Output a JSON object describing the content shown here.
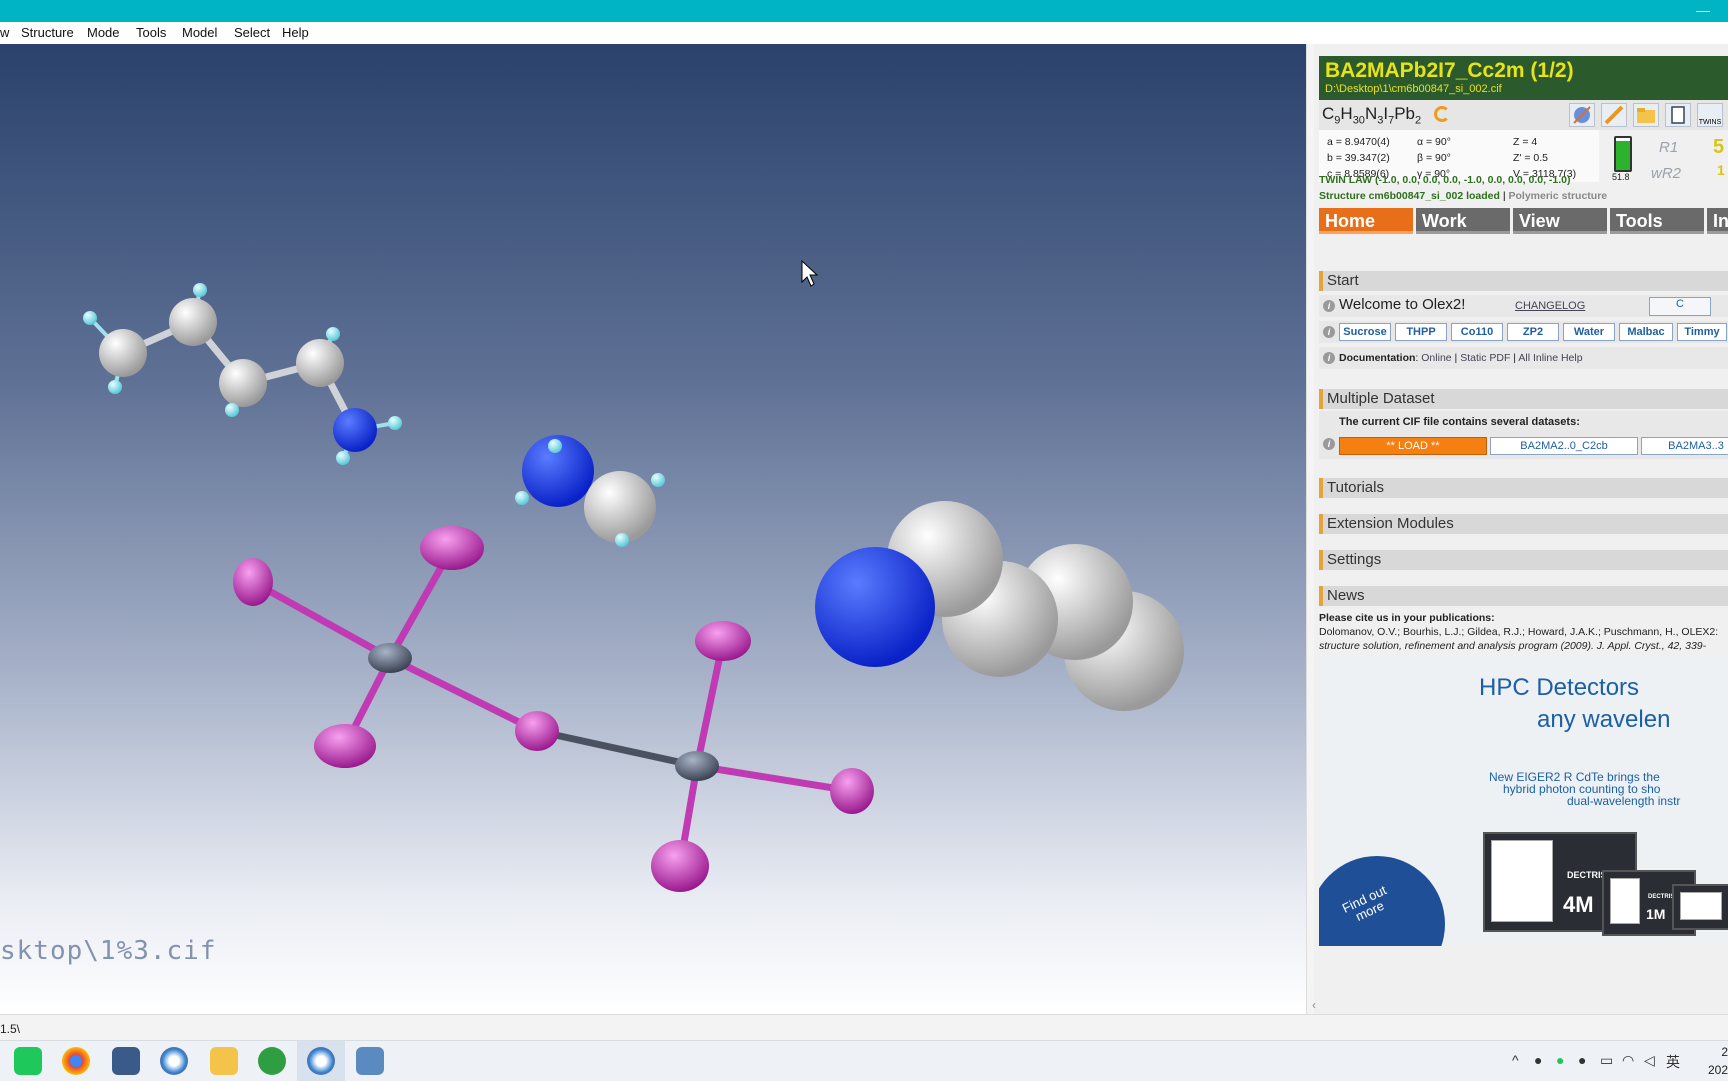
{
  "menu": [
    "w",
    "Structure",
    "Mode",
    "Tools",
    "Model",
    "Select",
    "Help"
  ],
  "viewport": {
    "path_text": "sktop\\1%3.cif",
    "bg_top": "#2a426c",
    "bg_bottom": "#ffffff"
  },
  "status": {
    "text": "1.5\\"
  },
  "header": {
    "title": "BA2MAPb2I7_Cc2m (1/2)",
    "path": "D:\\Desktop\\1\\cm6b00847_si_002.cif",
    "bg": "#2b5a2d",
    "title_color": "#e8e21a"
  },
  "formula": {
    "parts": [
      "C",
      "9",
      "H",
      "30",
      "N",
      "3",
      "I",
      "7",
      "Pb",
      "2"
    ]
  },
  "tool_icons": [
    "wand-icon",
    "pencil-icon",
    "folder-icon",
    "page-icon",
    "twins-icon"
  ],
  "twins_label": "TWINS",
  "cell": {
    "a": "a = 8.9470(4)",
    "b": "b = 39.347(2)",
    "c": "c = 8.8589(6)",
    "alpha": "α = 90°",
    "beta": "β = 90°",
    "gamma": "γ = 90°",
    "z": "Z = 4",
    "zp": "Z' = 0.5",
    "v": "V = 3118.7(3)"
  },
  "battery": "51.8",
  "r1_label": "R1",
  "wr2_label": "wR2",
  "r1_value": "5",
  "wr2_value": "1",
  "twin_law": "TWIN LAW (-1.0, 0.0, 0.0, 0.0, -1.0, 0.0, 0.0, 0.0, -1.0)",
  "loaded": {
    "main": "Structure cm6b00847_si_002 loaded",
    "sep": " | ",
    "extra": "Polymeric structure"
  },
  "tabs": [
    "Home",
    "Work",
    "View",
    "Tools",
    "In"
  ],
  "sections": {
    "start": "Start",
    "multi": "Multiple Dataset",
    "tutorials": "Tutorials",
    "ext": "Extension Modules",
    "settings": "Settings",
    "news": "News"
  },
  "start": {
    "welcome": "Welcome to Olex2!",
    "changelog": "CHANGELOG",
    "corner": "C",
    "samples": [
      "Sucrose",
      "THPP",
      "Co110",
      "ZP2",
      "Water",
      "Malbac",
      "Timmy"
    ],
    "doc_label": "Documentation",
    "doc_colon": ": ",
    "doc_online": "Online",
    "doc_sep1": " | ",
    "doc_pdf": "Static PDF",
    "doc_sep2": " | ",
    "doc_inline": "All Inline Help"
  },
  "multi": {
    "message": "The current CIF file contains several datasets:",
    "buttons": [
      "** LOAD **",
      "BA2MA2..0_C2cb",
      "BA2MA3..3"
    ]
  },
  "news": {
    "cite_head": "Please cite us in your publications:",
    "cite_authors": "Dolomanov, O.V.; Bourhis, L.J.; Gildea, R.J.; Howard, J.A.K.; Puschmann, H., OLEX2:",
    "cite_line2": "structure solution, refinement and analysis program (2009). J. Appl. Cryst., 42, 339-"
  },
  "banner": {
    "title1": "HPC Detectors",
    "title2": "any wavelen",
    "sub1": "New EIGER2 R CdTe brings the",
    "sub2": "hybrid photon counting to sho",
    "sub3": "dual-wavelength instr",
    "find_out": "Find out more",
    "det1": "4M",
    "det2": "1M",
    "brand": "DECTRIS",
    "accent": "#1c5fa6"
  },
  "taskbar": {
    "apps": [
      "wechat-icon",
      "chrome-icon",
      "calculator-icon",
      "olex-icon",
      "folder-icon",
      "chemdraw-icon",
      "olex2-active-icon",
      "notes-icon"
    ],
    "tray_lang": "英",
    "clock_time": "2",
    "clock_date": "202"
  }
}
